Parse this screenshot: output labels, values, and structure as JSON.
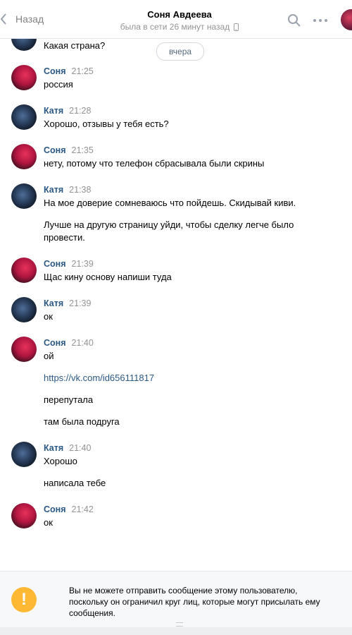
{
  "header": {
    "back_label": "Назад",
    "title": "Соня Авдеева",
    "subtitle": "была в сети 26 минут назад"
  },
  "date_divider": "вчера",
  "top_partial_text": "Какая страна?",
  "messages": [
    {
      "author": "Соня",
      "time": "21:25",
      "lines": [
        "россия"
      ]
    },
    {
      "author": "Катя",
      "time": "21:28",
      "lines": [
        "Хорошо, отзывы у тебя есть?"
      ]
    },
    {
      "author": "Соня",
      "time": "21:35",
      "lines": [
        "нету, потому что телефон сбрасывала были скрины"
      ]
    },
    {
      "author": "Катя",
      "time": "21:38",
      "lines": [
        "На мое доверие сомневаюсь что пойдешь. Скидывай киви.",
        "Лучше на другую страницу уйди, чтобы сделку легче было",
        "провести."
      ]
    },
    {
      "author": "Соня",
      "time": "21:39",
      "lines": [
        "Щас кину основу напиши туда"
      ]
    },
    {
      "author": "Катя",
      "time": "21:39",
      "lines": [
        "ок"
      ]
    },
    {
      "author": "Соня",
      "time": "21:40",
      "lines": [
        "ой",
        "https://vk.com/id656111817",
        "перепутала",
        "там была подруга"
      ]
    },
    {
      "author": "Катя",
      "time": "21:40",
      "lines": [
        "Хорошо",
        "написала тебе"
      ]
    },
    {
      "author": "Соня",
      "time": "21:42",
      "lines": [
        "ок"
      ]
    }
  ],
  "footer": {
    "warning_text": "Вы не можете отправить сообщение этому пользователю, поскольку он ограничил круг лиц, которые могут присылать ему сообщения.",
    "warning_glyph": "!"
  },
  "colors": {
    "accent": "#2a5885",
    "warning": "#ffb833",
    "muted": "#939393"
  }
}
